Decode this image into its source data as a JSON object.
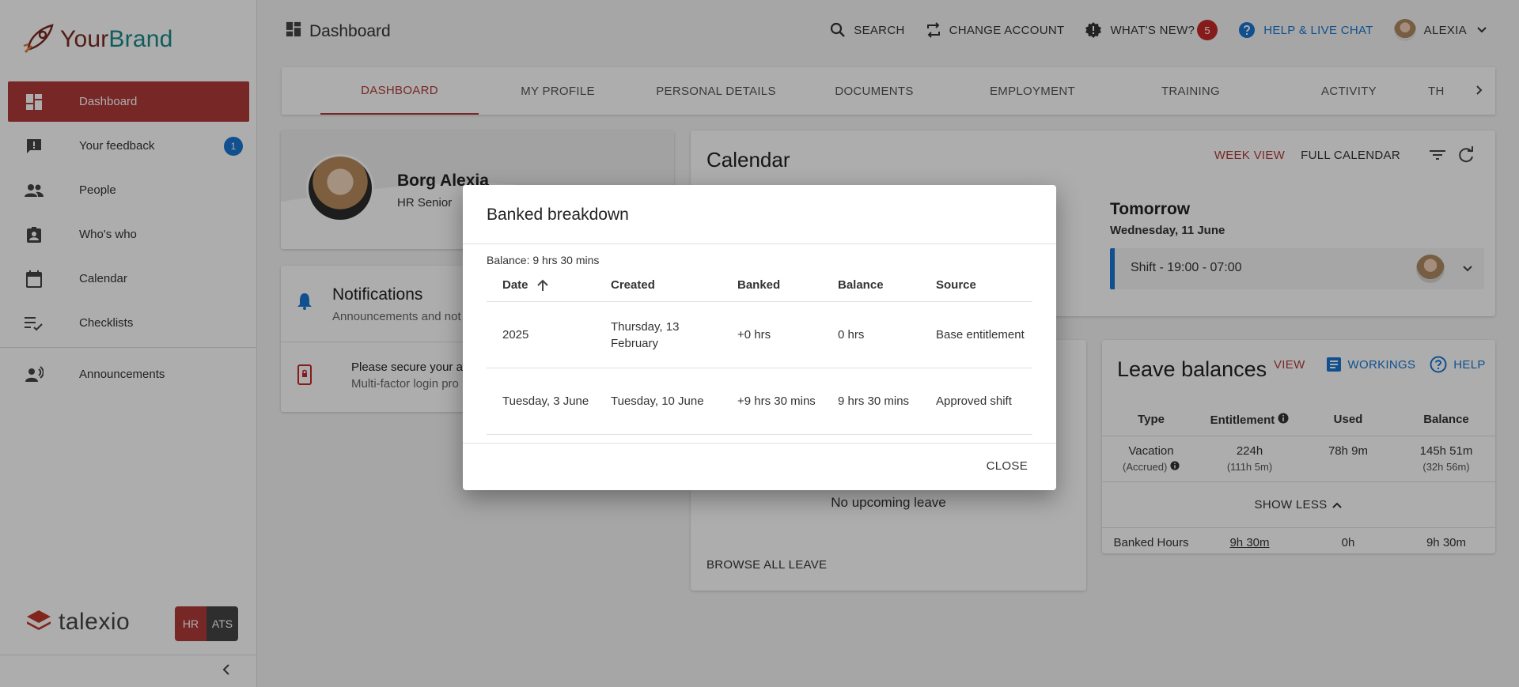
{
  "brand": {
    "part1": "Your",
    "part2": "Brand"
  },
  "sidebar": {
    "items": [
      {
        "label": "Dashboard",
        "icon": "dashboard-icon"
      },
      {
        "label": "Your feedback",
        "icon": "feedback-icon",
        "badge": "1"
      },
      {
        "label": "People",
        "icon": "people-icon"
      },
      {
        "label": "Who's who",
        "icon": "badge-icon"
      },
      {
        "label": "Calendar",
        "icon": "calendar-icon"
      },
      {
        "label": "Checklists",
        "icon": "checklist-icon"
      },
      {
        "label": "Announcements",
        "icon": "announcement-icon"
      }
    ],
    "footer": {
      "logo_text": "talexio",
      "hr": "HR",
      "ats": "ATS"
    }
  },
  "header": {
    "title": "Dashboard",
    "search": "SEARCH",
    "change_account": "CHANGE ACCOUNT",
    "whats_new": "WHAT'S NEW?",
    "whats_new_count": "5",
    "help": "HELP & LIVE CHAT",
    "user": "ALEXIA"
  },
  "tabs": [
    "DASHBOARD",
    "MY PROFILE",
    "PERSONAL DETAILS",
    "DOCUMENTS",
    "EMPLOYMENT",
    "TRAINING",
    "ACTIVITY",
    "TH"
  ],
  "profile": {
    "name": "Borg Alexia",
    "role": "HR Senior"
  },
  "notifications": {
    "title": "Notifications",
    "subtitle": "Announcements and not",
    "item_line1": "Please secure your a",
    "item_line2": "Multi-factor login pro"
  },
  "calendar": {
    "title": "Calendar",
    "week_view": "WEEK VIEW",
    "full_calendar": "FULL CALENDAR",
    "tomorrow_label": "Tomorrow",
    "tomorrow_date": "Wednesday, 11 June",
    "shift": "Shift - 19:00 - 07:00"
  },
  "leave": {
    "no_upcoming": "No upcoming leave",
    "browse_all": "BROWSE ALL LEAVE"
  },
  "leave_balances": {
    "title": "Leave balances",
    "view": "VIEW",
    "workings": "WORKINGS",
    "help": "HELP",
    "headers": [
      "Type",
      "Entitlement",
      "Used",
      "Balance"
    ],
    "vacation": {
      "type": "Vacation",
      "type_sub": "(Accrued)",
      "entitlement": "224h",
      "entitlement_sub": "(111h 5m)",
      "used": "78h 9m",
      "balance": "145h 51m",
      "balance_sub": "(32h 56m)"
    },
    "show_less": "SHOW LESS",
    "banked": {
      "type": "Banked Hours",
      "entitlement": "9h 30m",
      "used": "0h",
      "balance": "9h 30m"
    }
  },
  "dialog": {
    "title": "Banked breakdown",
    "balance": "Balance: 9 hrs 30 mins",
    "headers": [
      "Date",
      "Created",
      "Banked",
      "Balance",
      "Source"
    ],
    "rows": [
      {
        "date": "2025",
        "created": "Thursday, 13 February",
        "banked": "+0 hrs",
        "balance": "0 hrs",
        "source": "Base entitlement"
      },
      {
        "date": "Tuesday, 3 June",
        "created": "Tuesday, 10 June",
        "banked": "+9 hrs 30 mins",
        "balance": "9 hrs 30 mins",
        "source": "Approved shift"
      }
    ],
    "close": "CLOSE"
  },
  "colors": {
    "accent": "#b23a3a",
    "link": "#1976d2",
    "badge": "#c62828"
  }
}
